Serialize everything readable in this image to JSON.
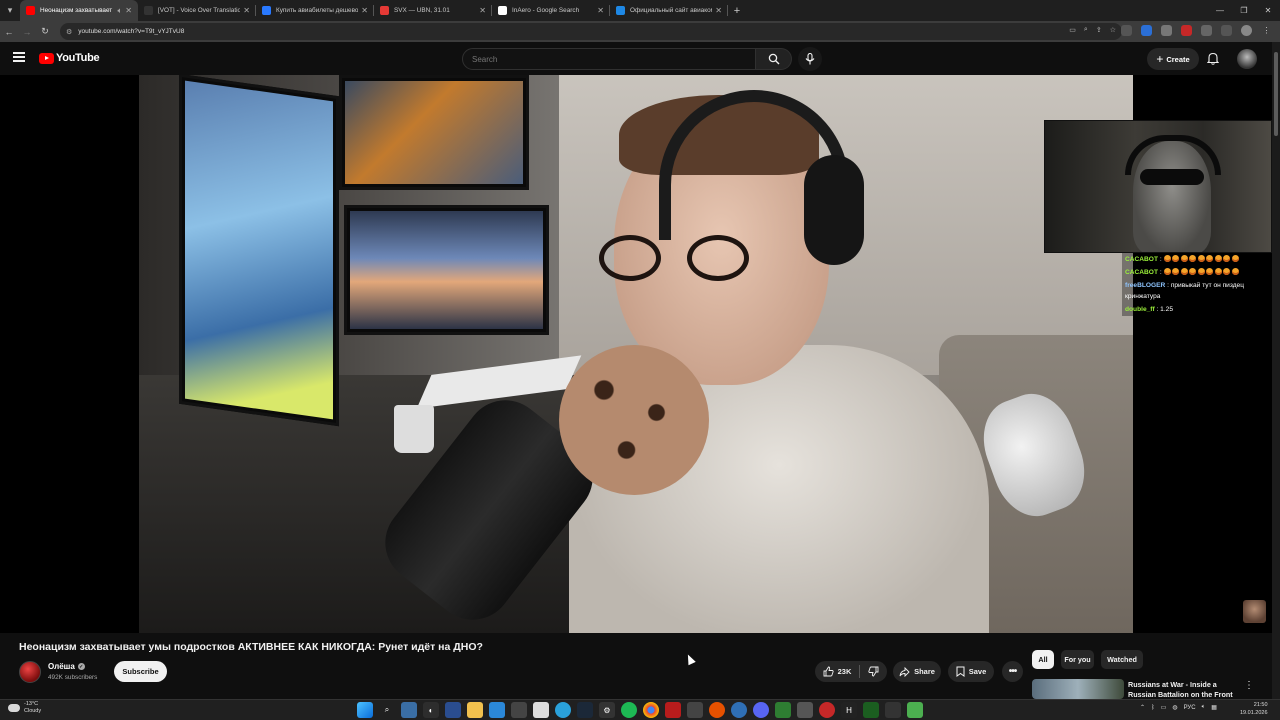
{
  "browser": {
    "tabs": [
      {
        "label": "Неонацизм захватывает умы",
        "active": true,
        "favicon_color": "#ff0000"
      },
      {
        "label": "[VOT] - Voice Over Translation",
        "active": false,
        "favicon_color": "#333333"
      },
      {
        "label": "Купить авиабилеты дешево с",
        "active": false,
        "favicon_color": "#2979ff"
      },
      {
        "label": "SVX — UBN, 31.01",
        "active": false,
        "favicon_color": "#e53935"
      },
      {
        "label": "InAero - Google Search",
        "active": false,
        "favicon_color": "#ffffff"
      },
      {
        "label": "Официальный сайт авиакомп",
        "active": false,
        "favicon_color": "#1e88e5"
      }
    ],
    "url": "youtube.com/watch?v=T9t_vYJTvU8"
  },
  "youtube": {
    "logo_text": "YouTube",
    "search_placeholder": "Search",
    "create_label": "Create"
  },
  "chat": {
    "lines": [
      {
        "nick": "CACABOT",
        "nick_color": "#9bf03a",
        "text": ":",
        "emoji_count": 9
      },
      {
        "nick": "CACABOT",
        "nick_color": "#9bf03a",
        "text": ":",
        "emoji_count": 9
      },
      {
        "nick": "freeBLOGER",
        "nick_color": "#8ec5ff",
        "text": ": привыкай тут он пиздец кринжатура",
        "emoji_count": 0
      },
      {
        "nick": "double_ff",
        "nick_color": "#9bf03a",
        "text": ": 1.25",
        "emoji_count": 0
      }
    ]
  },
  "video": {
    "title": "Неонацизм захватывает умы подростков АКТИВНЕЕ КАК НИКОГДА: Рунет идёт на ДНО?",
    "channel_name": "Олёша",
    "subscribers": "492K subscribers",
    "subscribe_label": "Subscribe",
    "likes": "23K",
    "share_label": "Share",
    "save_label": "Save"
  },
  "sidebar": {
    "chips": [
      "All",
      "For you",
      "Watched"
    ],
    "active_chip": "All",
    "recommendation": {
      "title": "Russians at War - Inside a Russian Battalion on the Front"
    }
  },
  "taskbar": {
    "weather_temp": "-13°C",
    "weather_desc": "Cloudy",
    "language": "РУС",
    "time": "21:50",
    "date": "19.01.2026"
  }
}
